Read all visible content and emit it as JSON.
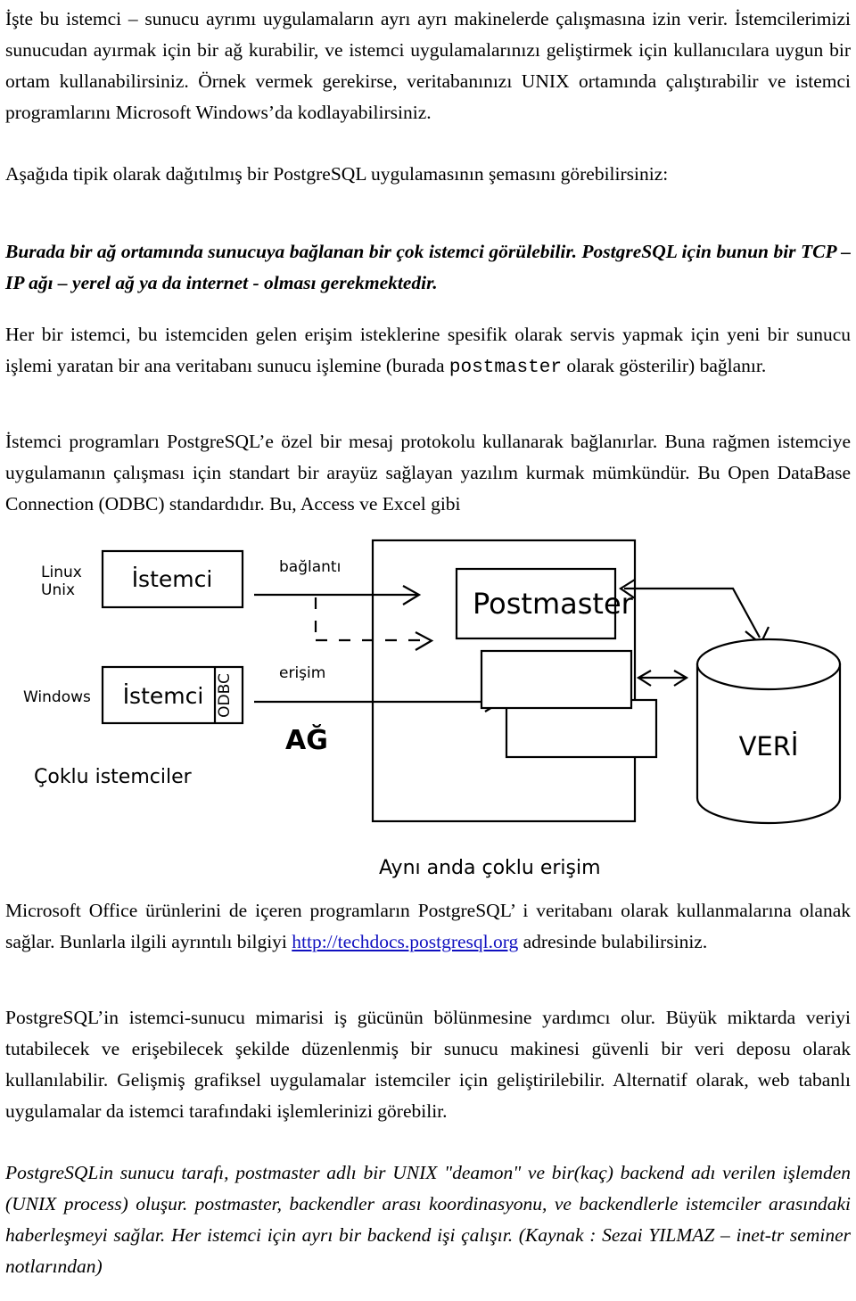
{
  "document": {
    "language": "tr",
    "paragraphs": [
      {
        "id": "p1",
        "style": "roman",
        "text": "İşte bu istemci – sunucu ayrımı uygulamaların ayrı ayrı makinelerde çalışmasına izin verir. İstemcilerimizi sunucudan ayırmak için bir ağ kurabilir, ve istemci uygulamalarınızı geliştirmek için kullanıcılara uygun bir ortam kullanabilirsiniz. Örnek vermek gerekirse, veritabanınızı UNIX ortamında çalıştırabilir ve istemci programlarını Microsoft Windows’da kodlayabilirsiniz."
      },
      {
        "id": "p2",
        "style": "roman",
        "text": "Aşağıda tipik olarak dağıtılmış bir PostgreSQL uygulamasının şemasını görebilirsiniz:"
      },
      {
        "id": "p3",
        "style": "italic-bold",
        "text": "Burada bir ağ ortamında sunucuya bağlanan bir çok istemci görülebilir. PostgreSQL için bunun bir TCP – IP ağı – yerel ağ ya da internet - olması gerekmektedir."
      },
      {
        "id": "p4",
        "style": "roman-mixed",
        "text_before": "Her bir istemci, bu istemciden gelen erişim isteklerine spesifik olarak servis yapmak için yeni bir sunucu işlemi yaratan bir  ana veritabanı sunucu işlemine  (burada ",
        "mono_term": "postmaster",
        "text_after": " olarak gösterilir) bağlanır."
      },
      {
        "id": "p5",
        "style": "roman",
        "text": "İstemci programları PostgreSQL’e özel bir mesaj protokolu kullanarak bağlanırlar. Buna rağmen istemciye uygulamanın çalışması için standart bir arayüz  sağlayan yazılım kurmak mümkündür. Bu Open DataBase Connection (ODBC) standardıdır. Bu, Access ve Excel gibi"
      },
      {
        "id": "p6",
        "style": "roman-link",
        "text_before": "Microsoft Office ürünlerini de içeren programların PostgreSQL’ i veritabanı olarak kullanmalarına olanak sağlar. Bunlarla ilgili ayrıntılı bilgiyi ",
        "link_text": "http://techdocs.postgresql.org",
        "text_after": " adresinde bulabilirsiniz."
      },
      {
        "id": "p7",
        "style": "roman",
        "text": "PostgreSQL’in istemci-sunucu mimarisi iş gücünün bölünmesine yardımcı olur. Büyük miktarda veriyi tutabilecek ve erişebilecek şekilde düzenlenmiş bir sunucu makinesi güvenli bir veri deposu olarak kullanılabilir. Gelişmiş grafiksel uygulamalar istemciler için geliştirilebilir. Alternatif olarak, web tabanlı uygulamalar da istemci tarafındaki işlemlerinizi görebilir."
      },
      {
        "id": "p8",
        "style": "italic",
        "text": "PostgreSQLin sunucu tarafı, postmaster adlı bir UNIX \"deamon\" ve bir(kaç) backend adı verilen işlemden (UNIX process) oluşur. postmaster, backendler arası koordinasyonu, ve backendlerle istemciler arasındaki haberleşmeyi sağlar. Her istemci için ayrı bir backend işi çalışır. (Kaynak : Sezai YILMAZ – inet-tr seminer notlarından)"
      }
    ]
  },
  "diagram": {
    "name": "postgresql-client-server-architecture",
    "labels": {
      "os_linux_line1": "Linux",
      "os_linux_line2": "Unix",
      "os_windows": "Windows",
      "client_1": "İstemci",
      "client_2": "İstemci",
      "odbc": "ODBC",
      "clients_caption": "Çoklu istemciler",
      "connection": "bağlantı",
      "access": "erişim",
      "network": "AĞ",
      "postmaster": "Postmaster",
      "database": "VERİ",
      "server_caption": "Aynı anda çoklu erişim"
    },
    "colors": {
      "stroke": "#000000",
      "fill": "#ffffff",
      "link": "#1010c0"
    }
  }
}
